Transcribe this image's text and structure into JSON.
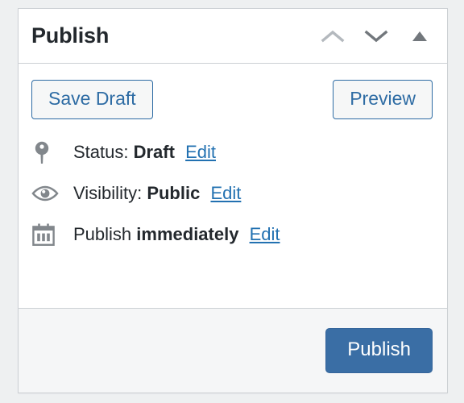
{
  "panel": {
    "title": "Publish",
    "header_icons": [
      {
        "name": "move-up-chevron-icon",
        "glyph": "chevron-up",
        "color": "#b4b9be",
        "state": "disabled"
      },
      {
        "name": "move-down-chevron-icon",
        "glyph": "chevron-down",
        "color": "#72777c",
        "state": "enabled"
      },
      {
        "name": "toggle-panel-triangle-icon",
        "glyph": "triangle-up",
        "color": "#72777c",
        "state": "expanded"
      }
    ]
  },
  "actions": {
    "save_draft_label": "Save Draft",
    "preview_label": "Preview"
  },
  "misc_rows": [
    {
      "icon": "post-status-pin-icon",
      "label": "Status:",
      "value": "Draft",
      "edit_label": "Edit"
    },
    {
      "icon": "visibility-eye-icon",
      "label": "Visibility:",
      "value": "Public",
      "edit_label": "Edit"
    },
    {
      "icon": "calendar-icon",
      "label": "Publish",
      "value": "immediately",
      "edit_label": "Edit"
    }
  ],
  "footer": {
    "publish_label": "Publish"
  },
  "colors": {
    "page_background": "#eef0f1",
    "card_background": "#ffffff",
    "card_border": "#ccd0d4",
    "footer_background": "#f5f6f7",
    "title_text": "#23282d",
    "secondary_button_text": "#2e6ca4",
    "secondary_button_border": "#2e6ca4",
    "secondary_button_background": "#f6f7f7",
    "primary_button_background": "#3a6ea5",
    "primary_button_text": "#ffffff",
    "link_blue": "#2271b1",
    "icon_gray": "#82878c"
  }
}
